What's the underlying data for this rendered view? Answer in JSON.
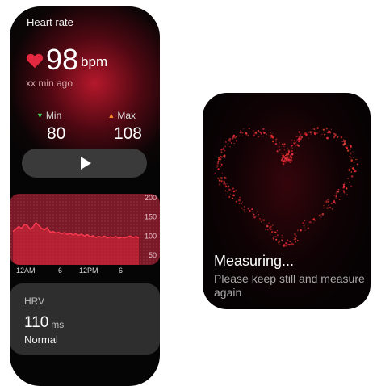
{
  "left_screen": {
    "title": "Heart rate",
    "heart_rate": {
      "value": "98",
      "unit": "bpm",
      "ago": "xx min ago"
    },
    "min": {
      "label": "Min",
      "value": "80"
    },
    "max": {
      "label": "Max",
      "value": "108"
    },
    "chart": {
      "y_ticks": [
        "200",
        "150",
        "100",
        "50"
      ],
      "x_ticks": [
        "12AM",
        "6",
        "12PM",
        "6"
      ],
      "ylim": [
        25,
        210
      ],
      "series_values": [
        112,
        118,
        125,
        120,
        130,
        128,
        118,
        123,
        135,
        128,
        120,
        116,
        122,
        110,
        112,
        108,
        110,
        106,
        109,
        104,
        107,
        103,
        106,
        102,
        105,
        100,
        104,
        98,
        101,
        96,
        99,
        97,
        100,
        95,
        98,
        96,
        99,
        94,
        97,
        95,
        98,
        100,
        96,
        99,
        95
      ]
    },
    "hrv": {
      "label": "HRV",
      "value": "110",
      "unit": "ms",
      "status": "Normal"
    },
    "colors": {
      "accent": "#e4283f",
      "chart_bg": "#7a1827",
      "min_arrow": "#3ccf5c",
      "max_arrow": "#ff8a2a"
    }
  },
  "right_screen": {
    "status": "Measuring...",
    "instruction": "Please keep still and measure again"
  }
}
